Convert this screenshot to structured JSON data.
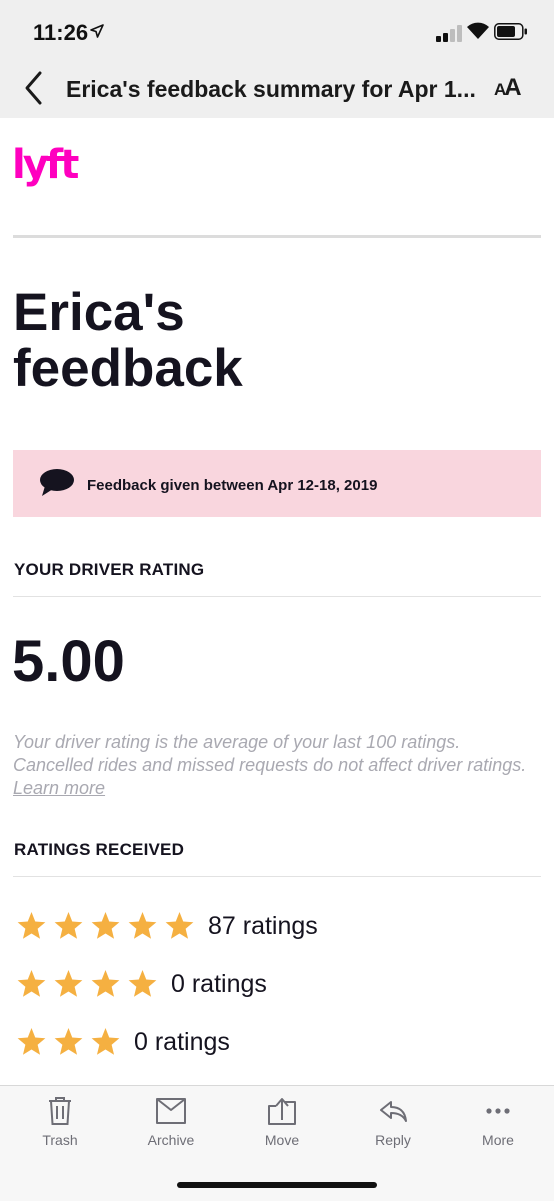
{
  "status_bar": {
    "time": "11:26"
  },
  "nav": {
    "title": "Erica's feedback summary for Apr 1...",
    "text_size_big": "A",
    "text_size_small": "A"
  },
  "email": {
    "brand": "lyft",
    "brand_color": "#ff00bf",
    "headline_line1": "Erica's",
    "headline_line2": "feedback",
    "banner_text": "Feedback given between Apr 12-18, 2019",
    "banner_color": "#f9d6de",
    "driver_rating_label": "YOUR DRIVER RATING",
    "driver_rating_value": "5.00",
    "rating_note": "Your driver rating is the average of your last 100 ratings. Cancelled rides and missed requests do not affect driver ratings.",
    "learn_more": "Learn more",
    "ratings_received_label": "RATINGS RECEIVED",
    "star_color": "#f5b041",
    "ratings": [
      {
        "stars": 5,
        "count_text": "87 ratings"
      },
      {
        "stars": 4,
        "count_text": "0 ratings"
      },
      {
        "stars": 3,
        "count_text": "0 ratings"
      }
    ]
  },
  "toolbar": {
    "trash": "Trash",
    "archive": "Archive",
    "move": "Move",
    "reply": "Reply",
    "more": "More"
  }
}
